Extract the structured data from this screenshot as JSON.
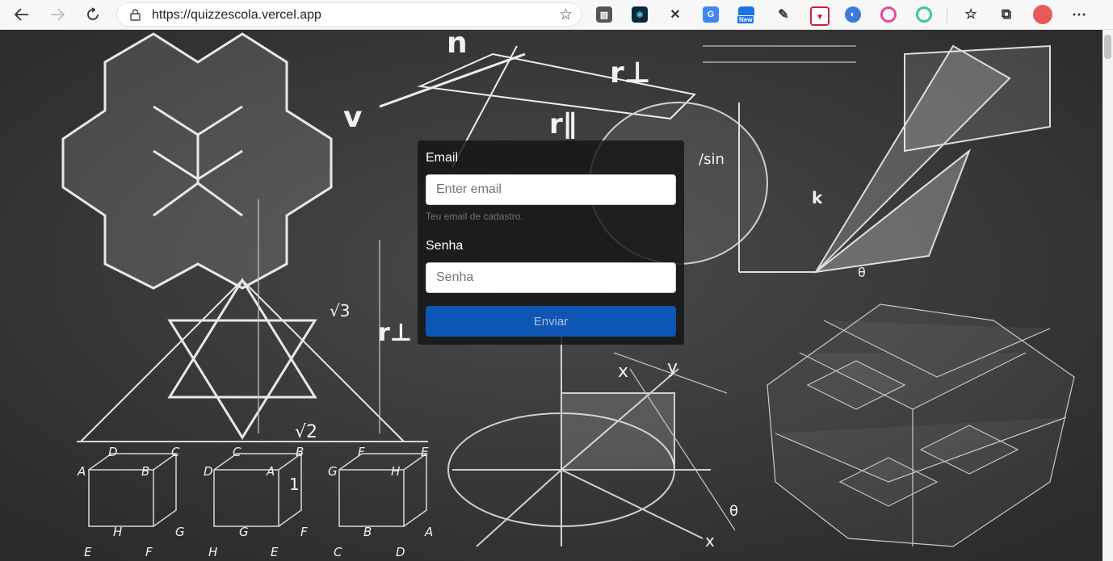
{
  "browser": {
    "url": "https://quizzescola.vercel.app",
    "extension_badge": "New"
  },
  "form": {
    "email_label": "Email",
    "email_placeholder": "Enter email",
    "email_value": "",
    "email_help": "Teu email de cadastro.",
    "password_label": "Senha",
    "password_placeholder": "Senha",
    "password_value": "",
    "submit_label": "Enviar"
  },
  "chalkboard": {
    "symbols": [
      "n",
      "v",
      "r⊥",
      "r∥",
      "/sin",
      "√3",
      "r⊥",
      "√2",
      "k",
      "θ",
      "x",
      "y",
      "θ",
      "x",
      "D",
      "C",
      "C",
      "B",
      "F",
      "E",
      "A",
      "B",
      "H",
      "G",
      "E",
      "F",
      "D",
      "A",
      "1",
      "G",
      "F",
      "H",
      "E",
      "G",
      "H",
      "A",
      "B",
      "C",
      "D"
    ]
  },
  "colors": {
    "accent": "#0d56b4",
    "card_bg": "#141414",
    "page_bg": "#3a3a3a"
  }
}
